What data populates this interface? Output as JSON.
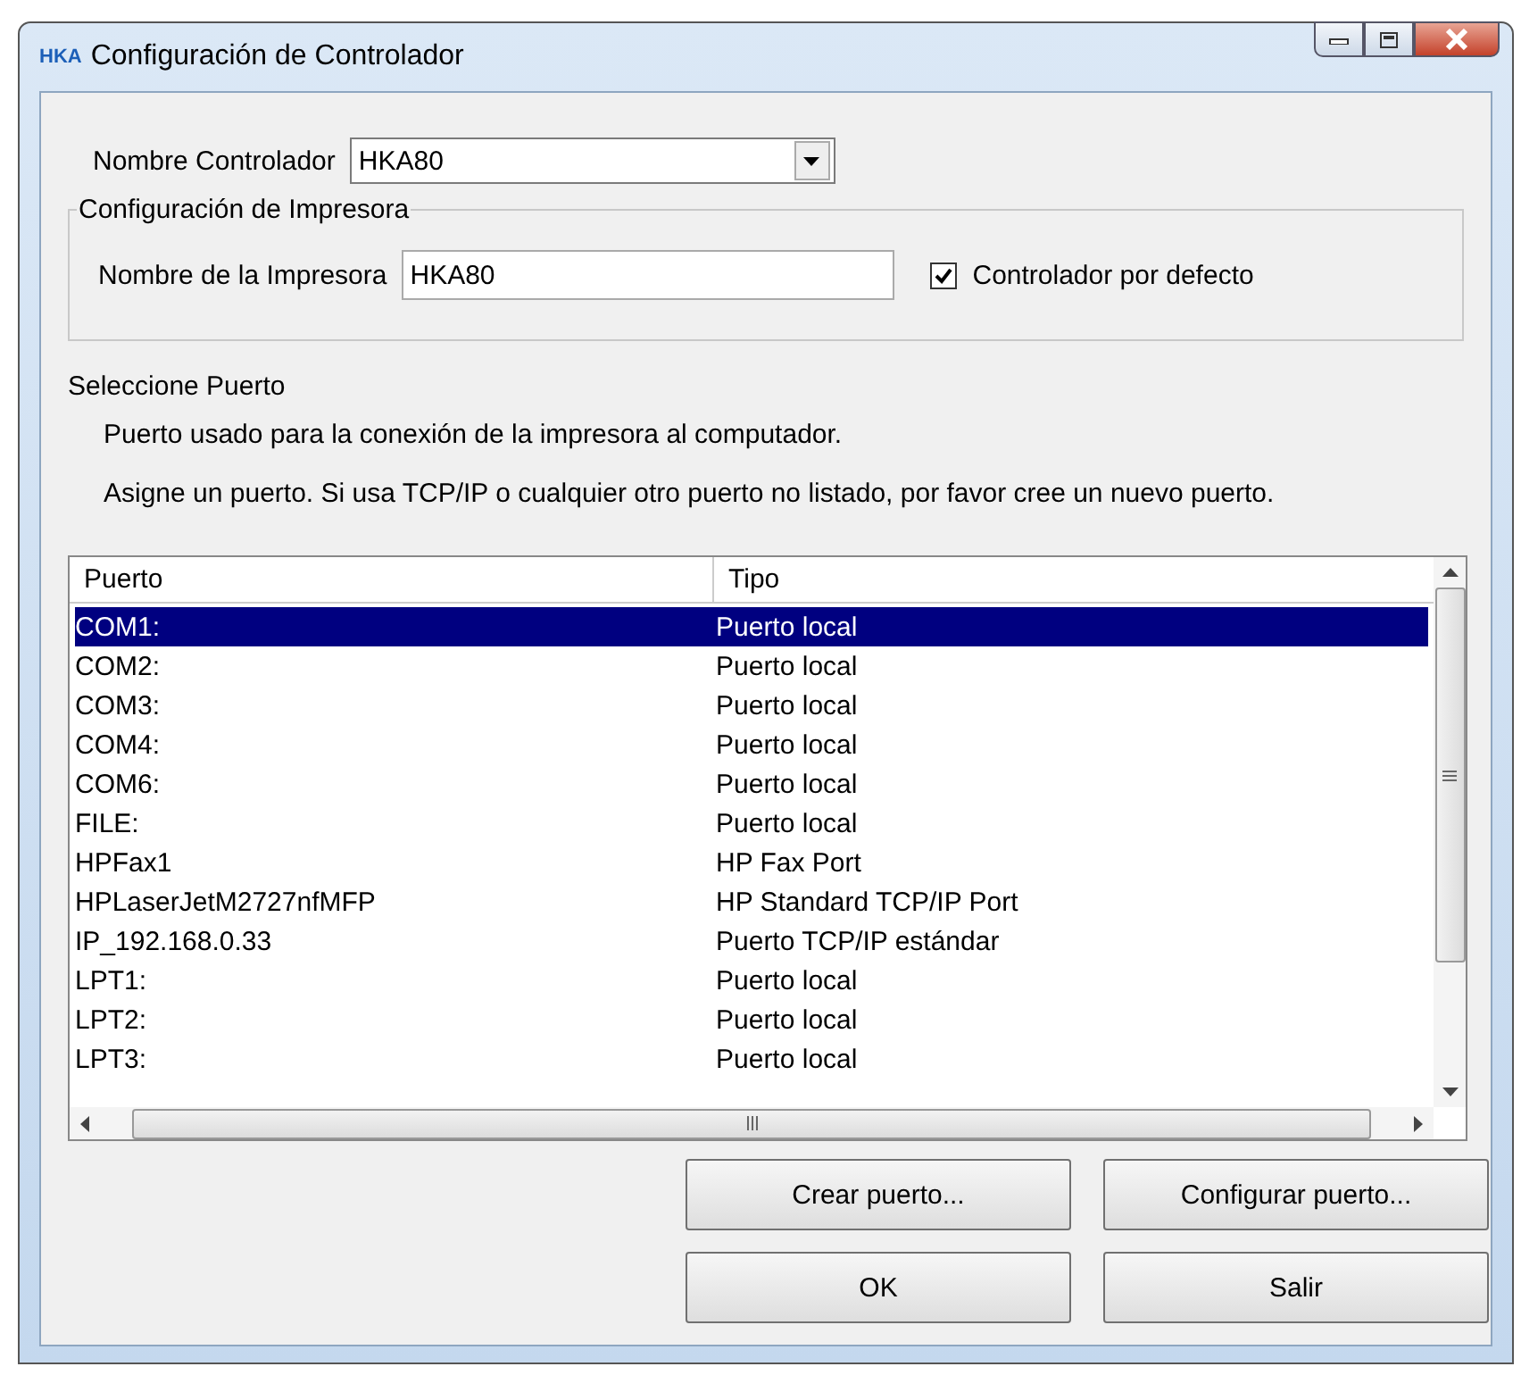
{
  "window": {
    "logo": "HKA",
    "title": "Configuración de Controlador"
  },
  "driver_name": {
    "label": "Nombre Controlador",
    "value": "HKA80"
  },
  "printer_config": {
    "title": "Configuración de Impresora",
    "printer_name_label": "Nombre de la Impresora",
    "printer_name": "HKA80",
    "default_driver": {
      "label": "Controlador por defecto",
      "checked": true
    }
  },
  "port_section": {
    "title": "Seleccione Puerto",
    "description": "Puerto usado para la conexión de la impresora al computador.",
    "hint": "Asigne un puerto. Si usa TCP/IP o cualquier otro puerto no listado, por favor cree un nuevo puerto."
  },
  "ports": {
    "columns": [
      "Puerto",
      "Tipo"
    ],
    "rows": [
      {
        "port": "COM1:",
        "type": "Puerto local",
        "selected": true
      },
      {
        "port": "COM2:",
        "type": "Puerto local",
        "selected": false
      },
      {
        "port": "COM3:",
        "type": "Puerto local",
        "selected": false
      },
      {
        "port": "COM4:",
        "type": "Puerto local",
        "selected": false
      },
      {
        "port": "COM6:",
        "type": "Puerto local",
        "selected": false
      },
      {
        "port": "FILE:",
        "type": "Puerto local",
        "selected": false
      },
      {
        "port": "HPFax1",
        "type": "HP Fax Port",
        "selected": false
      },
      {
        "port": "HPLaserJetM2727nfMFP",
        "type": "HP Standard TCP/IP Port",
        "selected": false
      },
      {
        "port": "IP_192.168.0.33",
        "type": "Puerto TCP/IP estándar",
        "selected": false
      },
      {
        "port": "LPT1:",
        "type": "Puerto local",
        "selected": false
      },
      {
        "port": "LPT2:",
        "type": "Puerto local",
        "selected": false
      },
      {
        "port": "LPT3:",
        "type": "Puerto local",
        "selected": false
      }
    ]
  },
  "buttons": [
    "Crear puerto...",
    "Configurar puerto...",
    "OK",
    "Salir"
  ]
}
